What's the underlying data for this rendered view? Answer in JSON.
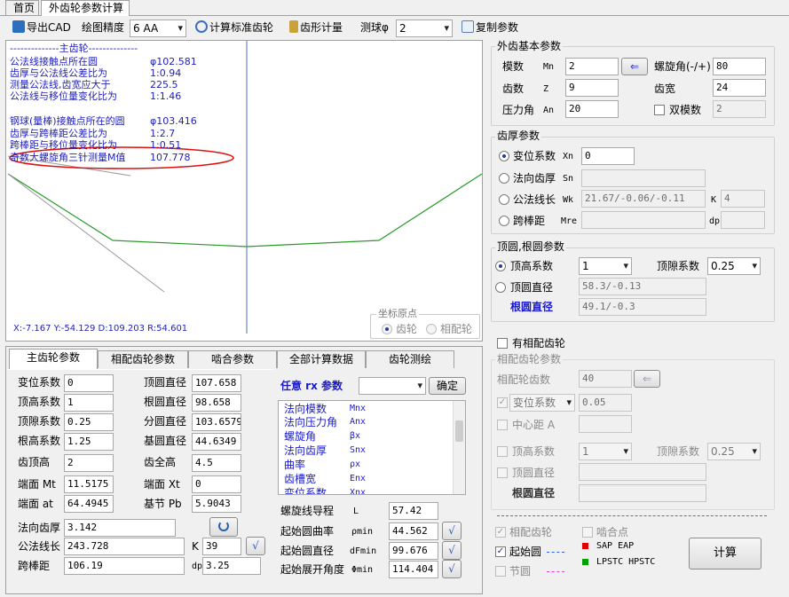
{
  "tabs": [
    {
      "label": "首页"
    },
    {
      "label": "外齿轮参数计算"
    }
  ],
  "toolbar": {
    "export_cad": "导出CAD",
    "precision_label": "绘图精度",
    "precision_value": "6  AA",
    "calc_standard": "计算标准齿轮",
    "measure": "齿形计量",
    "ball_label": "测球φ",
    "ball_value": "2",
    "copy": "复制参数"
  },
  "plot": {
    "lines": [
      "--------------主齿轮--------------",
      "公法线接触点所在圆",
      "齿厚与公法线公差比为",
      "测量公法线,齿宽应大于",
      "公法线与移位量变化比为",
      "钢球(量棒)接触点所在的圆",
      "齿厚与跨棒距公差比为",
      "跨棒距与移位量变化比为",
      "奇数大螺旋角三针测量M值"
    ],
    "values": [
      "",
      "φ102.581",
      "1:0.94",
      "225.5",
      "1:1.46",
      "φ103.416",
      "1:2.7",
      "1:0.51",
      "107.778"
    ],
    "status": "X:-7.167  Y:-54.129 D:109.203 R:54.601",
    "origin": {
      "title": "坐标原点",
      "gear": "齿轮",
      "mate": "相配轮"
    }
  },
  "bottom_tabs": [
    {
      "label": "主齿轮参数"
    },
    {
      "label": "相配齿轮参数"
    },
    {
      "label": "啮合参数"
    },
    {
      "label": "全部计算数据"
    },
    {
      "label": "齿轮测绘"
    }
  ],
  "main_params": {
    "rows": [
      {
        "l1": "变位系数",
        "v1": "0",
        "l2": "顶圆直径",
        "v2": "107.658"
      },
      {
        "l1": "顶高系数",
        "v1": "1",
        "l2": "根圆直径",
        "v2": "98.658"
      },
      {
        "l1": "顶隙系数",
        "v1": "0.25",
        "l2": "分圆直径",
        "v2": "103.6579"
      },
      {
        "l1": "根高系数",
        "v1": "1.25",
        "l2": "基圆直径",
        "v2": "44.6349"
      },
      {
        "l1": "齿顶高",
        "v1": "2",
        "l2": "齿全高",
        "v2": "4.5"
      },
      {
        "l1": "端面 Mt",
        "v1": "11.5175",
        "l2": "端面 Xt",
        "v2": "0"
      },
      {
        "l1": "端面 at",
        "v1": "64.4945",
        "l2": "基节 Pb",
        "v2": "5.9043"
      }
    ],
    "normal_thickness_label": "法向齿厚",
    "normal_thickness": "3.142",
    "wk_label": "公法线长",
    "wk": "243.728",
    "k_label": "K",
    "k": "39",
    "mre_label": "跨棒距",
    "mre": "106.19",
    "dp_label": "dp",
    "dp": "3.25"
  },
  "rx": {
    "title": "任意 rx 参数",
    "confirm": "确定",
    "items": [
      {
        "name": "法向模数",
        "sym": "Mnx"
      },
      {
        "name": "法向压力角",
        "sym": "Anx"
      },
      {
        "name": "螺旋角",
        "sym": "βx"
      },
      {
        "name": "法向齿厚",
        "sym": "Snx"
      },
      {
        "name": "曲率",
        "sym": "ρx"
      },
      {
        "name": "齿槽宽",
        "sym": "Enx"
      },
      {
        "name": "变位系数",
        "sym": "Xnx"
      }
    ]
  },
  "involute": [
    {
      "label": "螺旋线导程",
      "sym": "L",
      "value": "57.42"
    },
    {
      "label": "起始圆曲率",
      "sym": "ρmin",
      "value": "44.562"
    },
    {
      "label": "起始圆直径",
      "sym": "dFmin",
      "value": "99.676"
    },
    {
      "label": "起始展开角度",
      "sym": "Φmin",
      "value": "114.404"
    }
  ],
  "basic": {
    "title": "外齿基本参数",
    "module_label": "模数",
    "module_sym": "Mn",
    "module": "2",
    "helix_label": "螺旋角(-/+)",
    "helix": "80",
    "teeth_label": "齿数",
    "teeth_sym": "Z",
    "teeth": "9",
    "width_label": "齿宽",
    "width": "24",
    "pa_label": "压力角",
    "pa_sym": "An",
    "pa": "20",
    "dual_label": "双模数",
    "dual": "2"
  },
  "thickness": {
    "title": "齿厚参数",
    "x_label": "变位系数",
    "x_sym": "Xn",
    "x": "0",
    "sn_label": "法向齿厚",
    "sn_sym": "Sn",
    "sn": "",
    "wk_label": "公法线长",
    "wk_sym": "Wk",
    "wk": "21.67/-0.06/-0.11",
    "k_label": "K",
    "k": "4",
    "mre_label": "跨棒距",
    "mre_sym": "Mre",
    "mre": "",
    "dp_label": "dp",
    "dp": ""
  },
  "tip": {
    "title": "顶圆,根圆参数",
    "addendum_label": "顶高系数",
    "addendum": "1",
    "clearance_label": "顶隙系数",
    "clearance": "0.25",
    "tip_dia_label": "顶圆直径",
    "tip_dia": "58.3/-0.13",
    "root_dia_label": "根圆直径",
    "root_dia": "49.1/-0.3"
  },
  "mate": {
    "has_label": "有相配齿轮",
    "title": "相配齿轮参数",
    "teeth_label": "相配轮齿数",
    "teeth": "40",
    "x_label": "变位系数",
    "x": "0.05",
    "center_label": "中心距 A",
    "center": "",
    "addendum_label": "顶高系数",
    "addendum": "1",
    "clearance_label": "顶隙系数",
    "clearance": "0.25",
    "tip_label": "顶圆直径",
    "tip": "",
    "root_label": "根圆直径",
    "root": ""
  },
  "legend": {
    "mate_gear": "相配齿轮",
    "mesh_point": "啮合点",
    "start_circle": "起始圆",
    "pitch_circle": "节圆",
    "sap": "SAP  EAP",
    "lpstc": "LPSTC  HPSTC",
    "calc": "计算",
    "colors": {
      "red": "#e00000",
      "green": "#00a000",
      "blue": "#3060e0",
      "magenta": "#e040e0"
    }
  }
}
